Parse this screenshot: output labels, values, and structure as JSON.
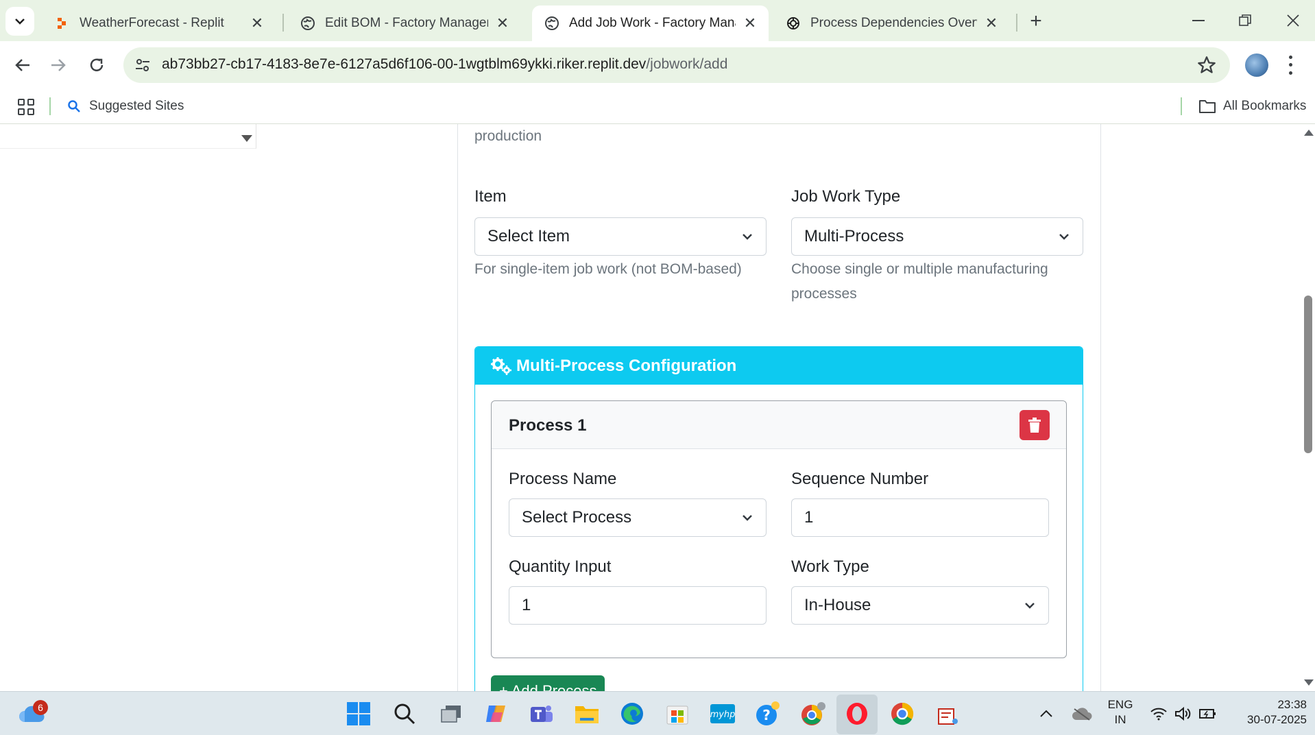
{
  "browser": {
    "tabs": [
      {
        "title": "WeatherForecast - Replit"
      },
      {
        "title": "Edit BOM - Factory Management"
      },
      {
        "title": "Add Job Work - Factory Management"
      },
      {
        "title": "Process Dependencies Overview"
      }
    ],
    "url_host": "ab73bb27-cb17-4183-8e7e-6127a5d6f106-00-1wgtblm69ykki.riker.replit.dev",
    "url_path": "/jobwork/add",
    "bookmarks": {
      "suggested": "Suggested Sites",
      "all": "All Bookmarks"
    }
  },
  "form": {
    "partial_help": "production",
    "item": {
      "label": "Item",
      "value": "Select Item",
      "help": "For single-item job work (not BOM-based)"
    },
    "job_work_type": {
      "label": "Job Work Type",
      "value": "Multi-Process",
      "help_line1": "Choose single or multiple manufacturing",
      "help_line2": "processes"
    },
    "multi_process": {
      "title": "Multi-Process Configuration",
      "process": {
        "title": "Process 1",
        "process_name": {
          "label": "Process Name",
          "value": "Select Process"
        },
        "sequence_number": {
          "label": "Sequence Number",
          "value": "1"
        },
        "quantity_input": {
          "label": "Quantity Input",
          "value": "1"
        },
        "work_type": {
          "label": "Work Type",
          "value": "In-House"
        }
      },
      "add_button": "+ Add Process"
    }
  },
  "taskbar": {
    "weather_badge": "6",
    "lang_line1": "ENG",
    "lang_line2": "IN",
    "time": "23:38",
    "date": "30-07-2025"
  },
  "colors": {
    "info": "#0dcaf0",
    "danger": "#dc3545",
    "success": "#198754",
    "chrome_bg": "#e9f3e5"
  }
}
